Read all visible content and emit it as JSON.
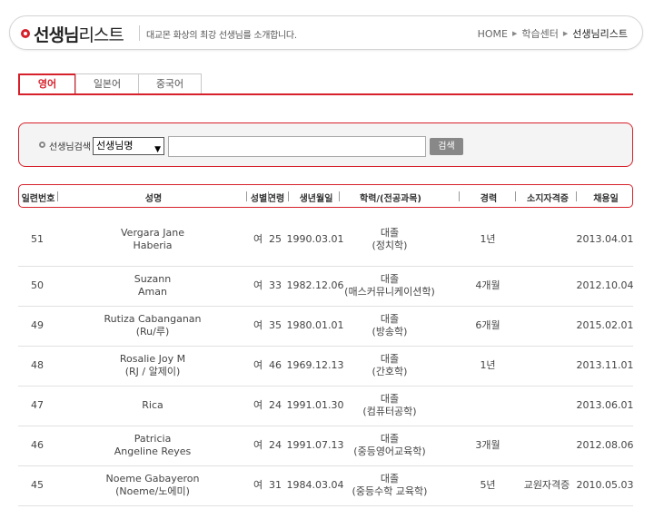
{
  "header": {
    "title_bold": "선생님",
    "title_light": "리스트",
    "description": "대교몬 화상의 최강 선생님를 소개합니다.",
    "breadcrumb": [
      "HOME",
      "학습센터",
      "선생님리스트"
    ]
  },
  "tabs": [
    {
      "label": "영어",
      "active": true
    },
    {
      "label": "일본어",
      "active": false
    },
    {
      "label": "중국어",
      "active": false
    }
  ],
  "search": {
    "label": "선생님검색",
    "select_value": "선생님명",
    "input_value": "",
    "button_label": "검색"
  },
  "table": {
    "columns": [
      "일련번호",
      "성명",
      "성별",
      "연령",
      "생년월일",
      "학력/(전공과목)",
      "경력",
      "소지자격증",
      "채용일"
    ],
    "rows": [
      {
        "no": "51",
        "name": [
          "Vergara Jane",
          "Haberia"
        ],
        "gender": "여",
        "age": "25",
        "birth": "1990.03.01",
        "edu": [
          "대졸",
          "(정치학)"
        ],
        "career": "1년",
        "cert": "",
        "hired": "2013.04.01"
      },
      {
        "no": "50",
        "name": [
          "Suzann",
          "Aman"
        ],
        "gender": "여",
        "age": "33",
        "birth": "1982.12.06",
        "edu": [
          "대졸",
          "(매스커뮤니케이션학)"
        ],
        "career": "4개월",
        "cert": "",
        "hired": "2012.10.04"
      },
      {
        "no": "49",
        "name": [
          "Rutiza Cabanganan",
          "(Ru/루)"
        ],
        "gender": "여",
        "age": "35",
        "birth": "1980.01.01",
        "edu": [
          "대졸",
          "(방송학)"
        ],
        "career": "6개월",
        "cert": "",
        "hired": "2015.02.01"
      },
      {
        "no": "48",
        "name": [
          "Rosalie Joy M",
          "(RJ / 알제이)"
        ],
        "gender": "여",
        "age": "46",
        "birth": "1969.12.13",
        "edu": [
          "대졸",
          "(간호학)"
        ],
        "career": "1년",
        "cert": "",
        "hired": "2013.11.01"
      },
      {
        "no": "47",
        "name": [
          "Rica"
        ],
        "gender": "여",
        "age": "24",
        "birth": "1991.01.30",
        "edu": [
          "대졸",
          "(컴퓨터공학)"
        ],
        "career": "",
        "cert": "",
        "hired": "2013.06.01"
      },
      {
        "no": "46",
        "name": [
          "Patricia",
          "Angeline Reyes"
        ],
        "gender": "여",
        "age": "24",
        "birth": "1991.07.13",
        "edu": [
          "대졸",
          "(중등영어교육학)"
        ],
        "career": "3개월",
        "cert": "",
        "hired": "2012.08.06"
      },
      {
        "no": "45",
        "name": [
          "Noeme Gabayeron",
          "(Noeme/노에미)"
        ],
        "gender": "여",
        "age": "31",
        "birth": "1984.03.04",
        "edu": [
          "대졸",
          "(중등수학 교육학)"
        ],
        "career": "5년",
        "cert": "교원자격증",
        "hired": "2010.05.03"
      }
    ]
  },
  "colors": {
    "accent": "#d6202a"
  }
}
